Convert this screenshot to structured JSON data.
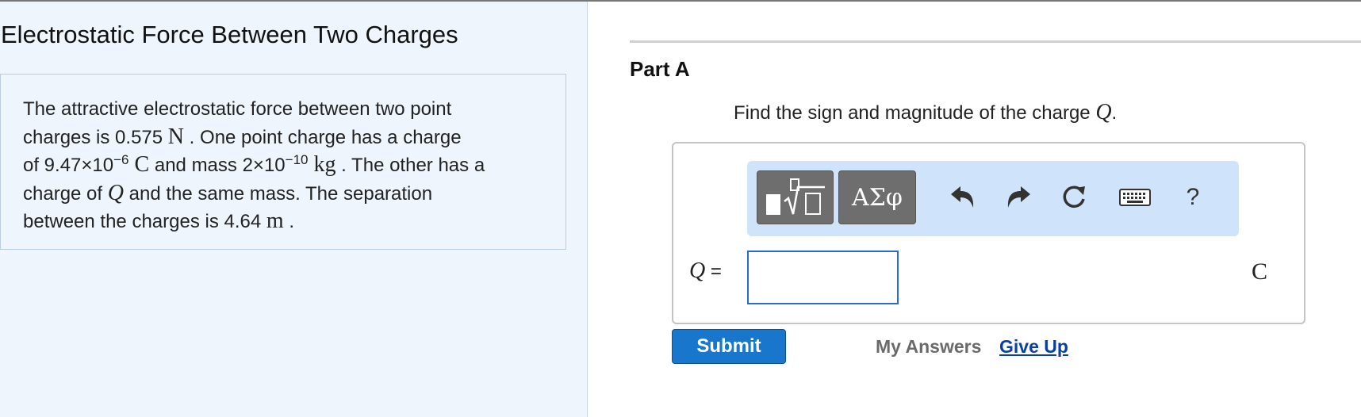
{
  "problem": {
    "title": "Electrostatic Force Between Two Charges",
    "text": {
      "l1": "The attractive electrostatic force between two point",
      "l2a": "charges is 0.575 ",
      "l2unit": "N",
      "l2b": " . One point charge has a charge",
      "l3a": "of 9.47×10",
      "l3exp1": "−6",
      "l3unit1": " C",
      "l3b": "  and mass 2×10",
      "l3exp2": "−10",
      "l3unit2": " kg",
      "l3c": " .  The other has a",
      "l4a": "charge of ",
      "l4var": "Q",
      "l4b": " and the same mass. The separation",
      "l5a": "between the charges is 4.64 ",
      "l5unit": "m",
      "l5b": "  ."
    }
  },
  "part": {
    "label": "Part A",
    "question_a": "Find the sign and magnitude of the charge ",
    "question_var": "Q",
    "question_b": "."
  },
  "toolbar": {
    "greek_label": "ΑΣφ",
    "help_label": "?"
  },
  "answer": {
    "variable": "Q",
    "equals": " =",
    "value": "",
    "unit": "C"
  },
  "actions": {
    "submit_label": "Submit",
    "my_answers_label": "My Answers",
    "give_up_label": "Give Up"
  }
}
